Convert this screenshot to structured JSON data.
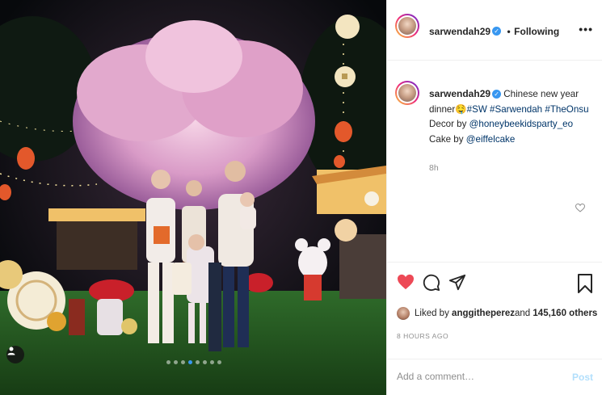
{
  "post": {
    "username": "sarwendah29",
    "follow_separator": "•",
    "follow_status": "Following",
    "more_icon": "more-horizontal-icon",
    "caption": {
      "text_1": "Chinese new year dinner",
      "emoji": "🤤",
      "tag_sw": "#SW",
      "tag_sarwendah": "#Sarwendah",
      "tag_theonsu": "#TheOnsu",
      "decor_label": "Decor by ",
      "decor_mention": "@honeybeekidsparty_eo",
      "cake_label": "Cake by ",
      "cake_mention": "@eiffelcake"
    },
    "caption_time": "8h",
    "liked_by_prefix": "Liked by ",
    "liked_by_user": "anggitheperez",
    "liked_by_and": " and ",
    "liked_by_count": "145,160 others",
    "time_ago": "8 HOURS AGO",
    "comment_placeholder": "Add a comment…",
    "post_button": "Post"
  },
  "carousel": {
    "total": 8,
    "active_index": 3
  },
  "colors": {
    "like_red": "#ed4956",
    "link_blue": "#003569",
    "verified_blue": "#3897f0",
    "muted_gray": "#8e8e8e",
    "post_disabled": "#b2dffc"
  },
  "icons": [
    "user-tag-icon",
    "heart-filled-icon",
    "comment-icon",
    "share-icon",
    "bookmark-icon",
    "small-heart-icon",
    "verified-badge-icon"
  ]
}
